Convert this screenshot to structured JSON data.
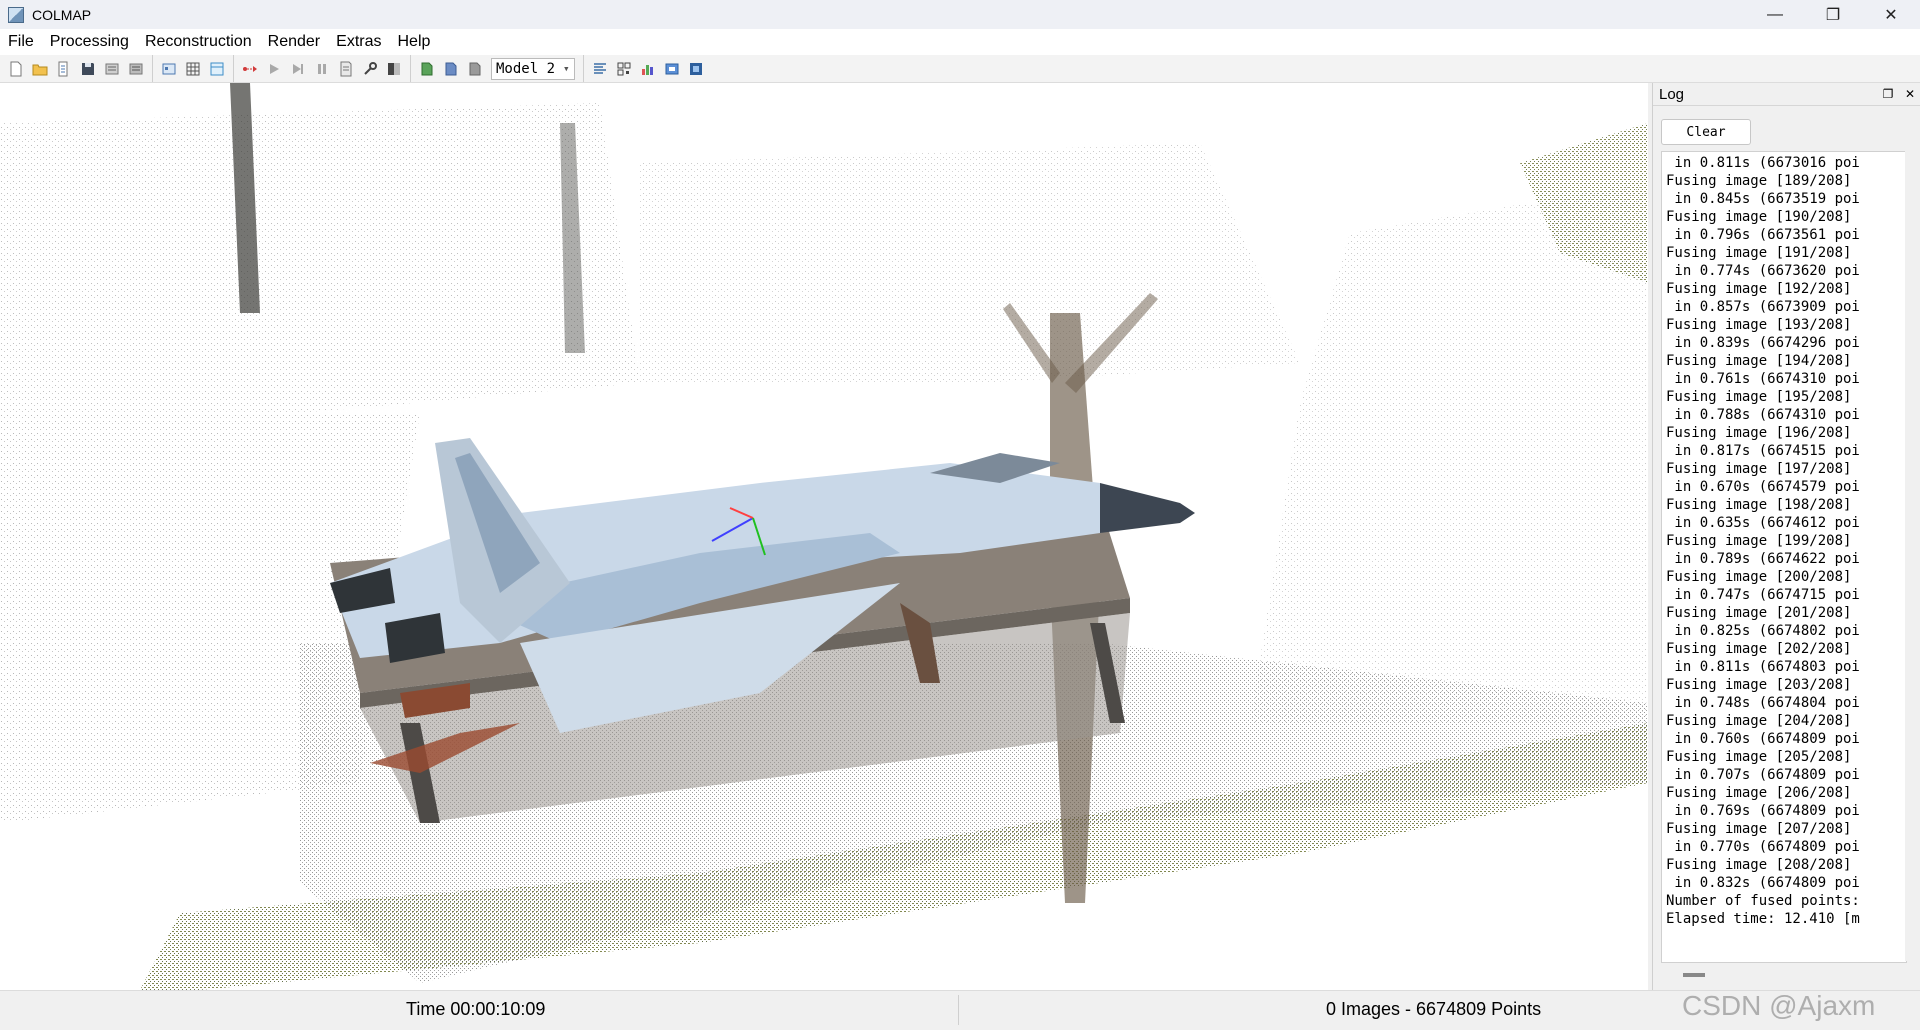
{
  "window": {
    "title": "COLMAP",
    "minimize": "—",
    "maximize": "❐",
    "close": "✕"
  },
  "menu": [
    "File",
    "Processing",
    "Reconstruction",
    "Render",
    "Extras",
    "Help"
  ],
  "toolbar": {
    "model_select": "Model 2"
  },
  "log": {
    "title": "Log",
    "clear_label": "Clear",
    "lines": [
      " in 0.811s (6673016 poi",
      "Fusing image [189/208]",
      " in 0.845s (6673519 poi",
      "Fusing image [190/208]",
      " in 0.796s (6673561 poi",
      "Fusing image [191/208]",
      " in 0.774s (6673620 poi",
      "Fusing image [192/208]",
      " in 0.857s (6673909 poi",
      "Fusing image [193/208]",
      " in 0.839s (6674296 poi",
      "Fusing image [194/208]",
      " in 0.761s (6674310 poi",
      "Fusing image [195/208]",
      " in 0.788s (6674310 poi",
      "Fusing image [196/208]",
      " in 0.817s (6674515 poi",
      "Fusing image [197/208]",
      " in 0.670s (6674579 poi",
      "Fusing image [198/208]",
      " in 0.635s (6674612 poi",
      "Fusing image [199/208]",
      " in 0.789s (6674622 poi",
      "Fusing image [200/208]",
      " in 0.747s (6674715 poi",
      "Fusing image [201/208]",
      " in 0.825s (6674802 poi",
      "Fusing image [202/208]",
      " in 0.811s (6674803 poi",
      "Fusing image [203/208]",
      " in 0.748s (6674804 poi",
      "Fusing image [204/208]",
      " in 0.760s (6674809 poi",
      "Fusing image [205/208]",
      " in 0.707s (6674809 poi",
      "Fusing image [206/208]",
      " in 0.769s (6674809 poi",
      "Fusing image [207/208]",
      " in 0.770s (6674809 poi",
      "Fusing image [208/208]",
      " in 0.832s (6674809 poi",
      "Number of fused points:",
      "Elapsed time: 12.410 [m"
    ]
  },
  "status": {
    "time": "Time 00:00:10:09",
    "summary": "0 Images - 6674809 Points"
  },
  "watermark": "CSDN @Ajaxm",
  "colors": {
    "window_bg": "#f0f0f0",
    "viewport_bg": "#ffffff",
    "titlebar_bg": "#eef0f5"
  }
}
